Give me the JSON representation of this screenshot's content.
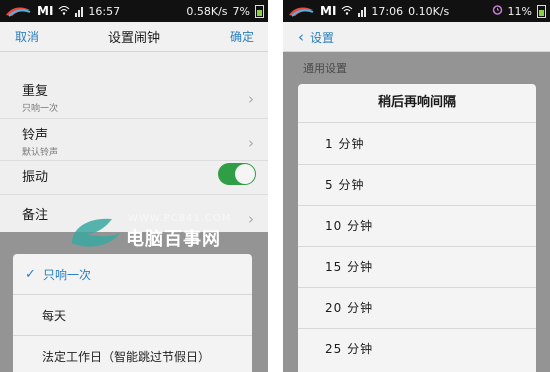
{
  "left": {
    "status": {
      "brand": "MI",
      "time": "16:57",
      "net_speed": "0.58K/s",
      "battery": "7%"
    },
    "titlebar": {
      "cancel": "取消",
      "title": "设置闹钟",
      "confirm": "确定"
    },
    "rows": [
      {
        "label": "重复",
        "sub": "只响一次"
      },
      {
        "label": "铃声",
        "sub": "默认铃声"
      },
      {
        "label": "振动",
        "toggle_on": true
      },
      {
        "label": "备注"
      }
    ],
    "sheet": {
      "options": [
        {
          "label": "只响一次",
          "selected": true
        },
        {
          "label": "每天",
          "selected": false
        },
        {
          "label": "法定工作日（智能跳过节假日）",
          "selected": false
        }
      ]
    },
    "watermark": {
      "url": "WWW.PC841.COM",
      "text": "电脑百事网"
    }
  },
  "right": {
    "status": {
      "brand": "MI",
      "time": "17:06",
      "net_speed": "0.10K/s",
      "battery": "11%"
    },
    "titlebar": {
      "back": "设置"
    },
    "section_header": "通用设置",
    "dialog": {
      "title": "稍后再响间隔",
      "items": [
        "1 分钟",
        "5 分钟",
        "10 分钟",
        "15 分钟",
        "20 分钟",
        "25 分钟"
      ]
    }
  },
  "colors": {
    "accent": "#2a7fbf",
    "toggle": "#2f9e44",
    "statusbar": "#111111"
  }
}
